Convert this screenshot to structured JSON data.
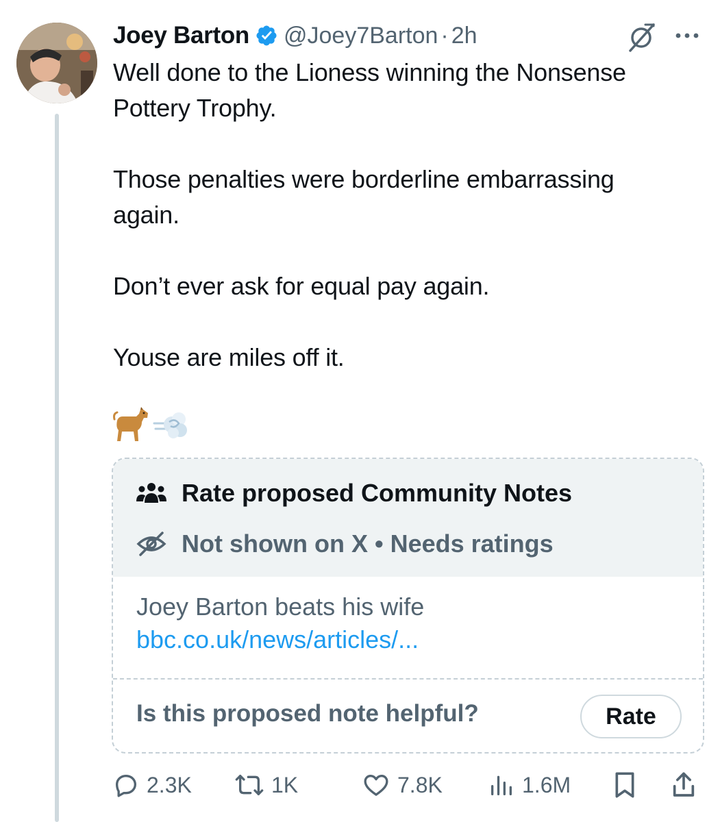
{
  "tweet": {
    "author": {
      "display_name": "Joey Barton",
      "handle": "@Joey7Barton",
      "verified": true,
      "avatar_icon": "profile-photo"
    },
    "separator": "·",
    "time": "2h",
    "header_icons": [
      "grok-icon",
      "more-icon"
    ],
    "text": "Well done to the Lioness winning the Nonsense\nPottery Trophy.\n\nThose penalties were borderline embarrassing\nagain.\n\nDon’t ever ask for equal pay again.\n\nYouse are miles off it.",
    "emojis": [
      "dog-emoji",
      "dash-emoji"
    ]
  },
  "community_note": {
    "title": "Rate proposed Community Notes",
    "title_icon": "people-icon",
    "status": "Not shown on X • Needs ratings",
    "status_icon": "eye-off-icon",
    "note_text": "Joey Barton beats his wife",
    "note_link": "bbc.co.uk/news/articles/...",
    "question": "Is this proposed note helpful?",
    "rate_label": "Rate"
  },
  "actions": {
    "replies": "2.3K",
    "reposts": "1K",
    "likes": "7.8K",
    "views": "1.6M"
  },
  "colors": {
    "text": "#0f1419",
    "secondary": "#536471",
    "link": "#1d9bf0",
    "verified": "#1d9bf0",
    "card_header_bg": "#eff3f4",
    "border": "#cfd9de"
  }
}
